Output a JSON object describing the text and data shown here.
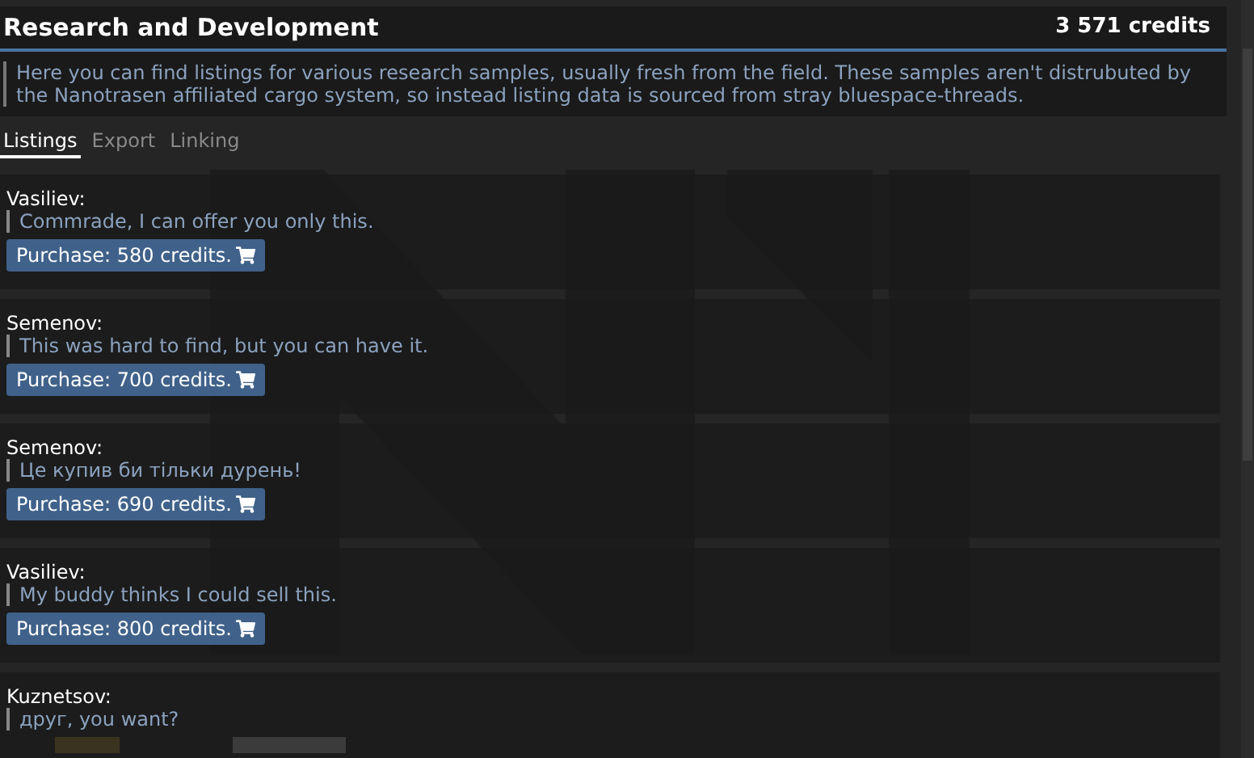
{
  "header": {
    "title": "Research and Development",
    "credits": "3 571 credits"
  },
  "notice": "Here you can find listings for various research samples, usually fresh from the field. These samples aren't distrubuted by the Nanotrasen affiliated cargo system, so instead listing data is sourced from stray bluespace-threads.",
  "tabs": [
    {
      "label": "Listings",
      "selected": true
    },
    {
      "label": "Export",
      "selected": false
    },
    {
      "label": "Linking",
      "selected": false
    }
  ],
  "listings": [
    {
      "seller": "Vasiliev:",
      "message": "Commrade, I can offer you only this.",
      "button": "Purchase: 580 credits."
    },
    {
      "seller": "Semenov:",
      "message": "This was hard to find, but you can have it.",
      "button": "Purchase: 700 credits."
    },
    {
      "seller": "Semenov:",
      "message": "Це купив би тільки дурень!",
      "button": "Purchase: 690 credits."
    },
    {
      "seller": "Vasiliev:",
      "message": "My buddy thinks I could sell this.",
      "button": "Purchase: 800 credits."
    },
    {
      "seller": "Kuznetsov:",
      "message": "друг, you want?"
    }
  ]
}
